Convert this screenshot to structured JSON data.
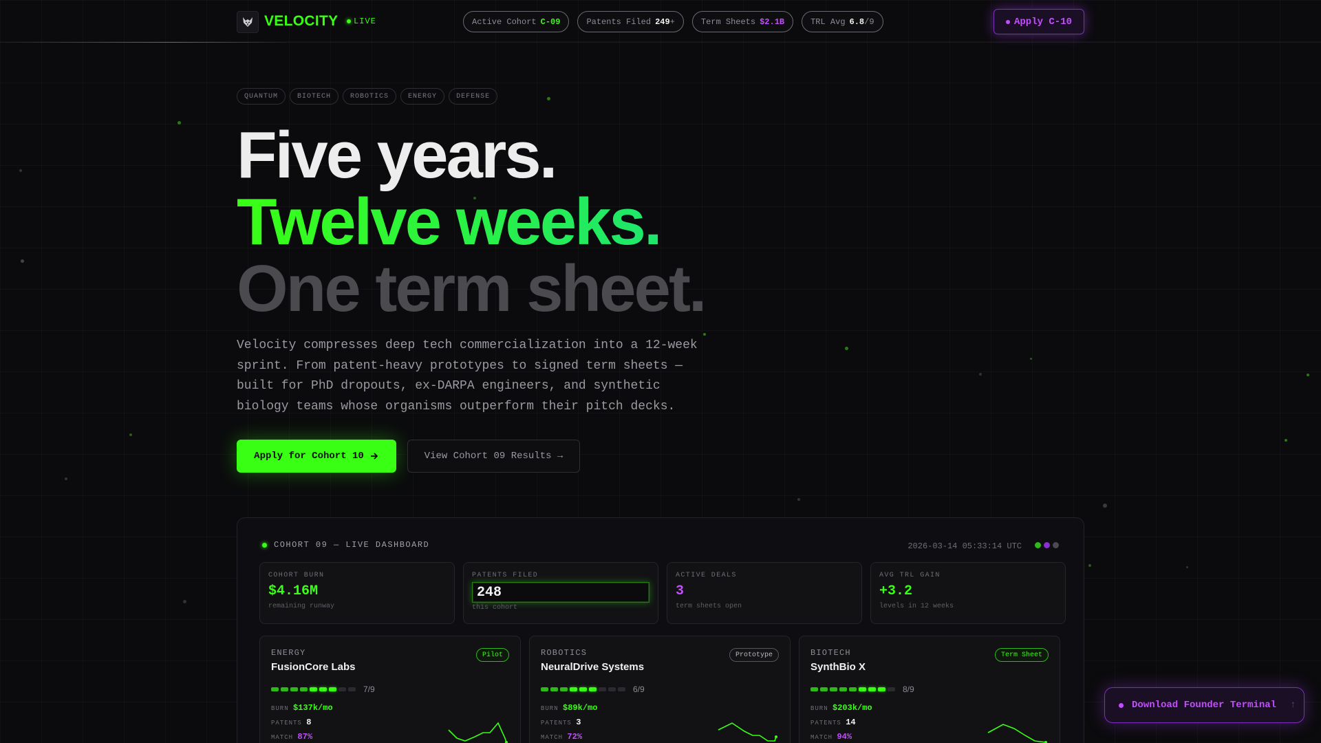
{
  "nav": {
    "brand": "VELOCITY",
    "live_label": "LIVE",
    "stats": [
      {
        "label": "Active Cohort",
        "value": "C-09",
        "suffix": ""
      },
      {
        "label": "Patents Filed",
        "value": "249",
        "suffix": "+"
      },
      {
        "label": "Term Sheets",
        "value": "$2.1B",
        "suffix": ""
      },
      {
        "label": "TRL Avg",
        "value": "6.8",
        "suffix": "/9"
      }
    ],
    "apply_label": "Apply C-10"
  },
  "hero": {
    "tags": [
      "QUANTUM",
      "BIOTECH",
      "ROBOTICS",
      "ENERGY",
      "DEFENSE"
    ],
    "line1": "Five years.",
    "line2": "Twelve weeks.",
    "line3": "One term sheet.",
    "lede": "Velocity compresses deep tech commercialization into a 12-week sprint. From patent-heavy prototypes to signed term sheets — built for PhD dropouts, ex-DARPA engineers, and synthetic biology teams whose organisms outperform their pitch decks.",
    "cta_primary": "Apply for Cohort 10",
    "cta_secondary": "View Cohort 09 Results →"
  },
  "dashboard": {
    "title": "COHORT 09 — LIVE DASHBOARD",
    "timestamp": "2026-03-14 05:33:14 UTC",
    "kpis": [
      {
        "label": "COHORT BURN",
        "value": "$4.16M",
        "sub": "remaining runway"
      },
      {
        "label": "PATENTS FILED",
        "value": "248",
        "sub": "this cohort"
      },
      {
        "label": "ACTIVE DEALS",
        "value": "3",
        "sub": "term sheets open"
      },
      {
        "label": "AVG TRL GAIN",
        "value": "+3.2",
        "sub": "levels in 12 weeks"
      }
    ],
    "metric_labels": {
      "burn": "BURN",
      "patents": "PATENTS",
      "match": "MATCH"
    },
    "cards": [
      {
        "sector": "ENERGY",
        "name": "FusionCore Labs",
        "stage": "Pilot",
        "trl": 7,
        "trl_text": "7/9",
        "burn": "$137k/mo",
        "patents": "8",
        "match": "87%"
      },
      {
        "sector": "ROBOTICS",
        "name": "NeuralDrive Systems",
        "stage": "Prototype",
        "trl": 6,
        "trl_text": "6/9",
        "burn": "$89k/mo",
        "patents": "3",
        "match": "72%"
      },
      {
        "sector": "BIOTECH",
        "name": "SynthBio X",
        "stage": "Term Sheet",
        "trl": 8,
        "trl_text": "8/9",
        "burn": "$203k/mo",
        "patents": "14",
        "match": "94%"
      }
    ]
  },
  "download_label": "Download Founder Terminal",
  "download_icon": "↑",
  "colors": {
    "accent_green": "#39ff14",
    "accent_purple": "#c44dff",
    "background": "#0b0b0d"
  }
}
